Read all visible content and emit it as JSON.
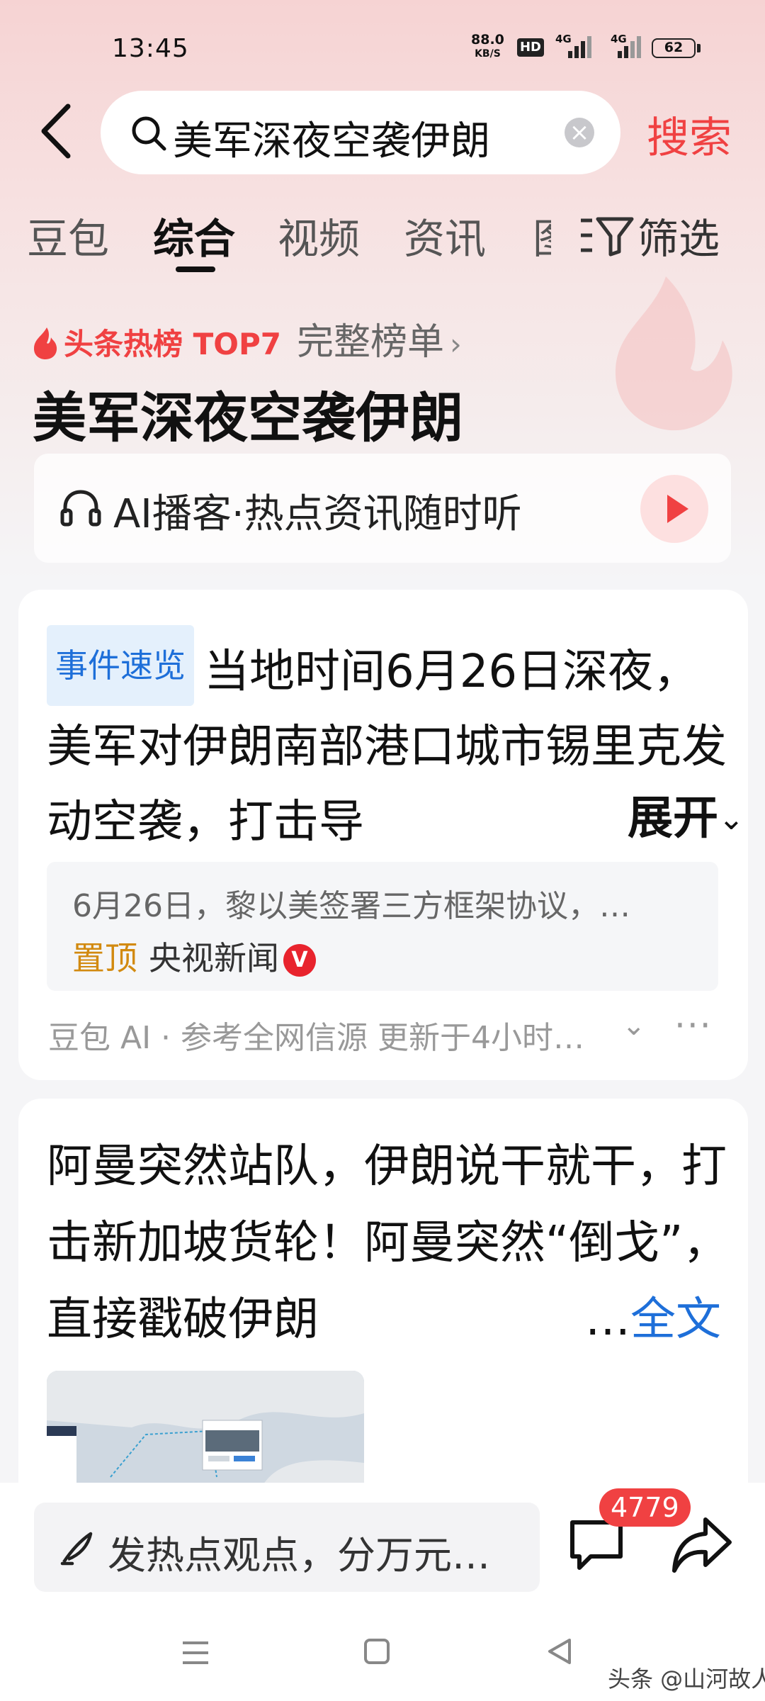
{
  "status_bar": {
    "time": "13:45",
    "net_speed_value": "88.0",
    "net_speed_unit": "KB/S",
    "hd_label": "HD",
    "net1": "4G",
    "net2": "4G",
    "battery": "62"
  },
  "search": {
    "query": "美军深夜空袭伊朗",
    "button_label": "搜索"
  },
  "tabs": {
    "items": [
      "豆包",
      "综合",
      "视频",
      "资讯"
    ],
    "active_index": 1,
    "partial_glyph": "图",
    "filter_label": "筛选"
  },
  "hot_rank": {
    "title": "头条热榜 TOP7",
    "link_label": "完整榜单",
    "chevron": "›",
    "topic": "美军深夜空袭伊朗"
  },
  "podcast": {
    "label": "AI播客·热点资讯随时听"
  },
  "summary_card": {
    "tag": "事件速览",
    "text": "当地时间6月26日深夜，美军对伊朗南部港口城市锡里克发动空袭，打击导",
    "expand_label": "展开",
    "reference_text": "6月26日，黎以美签署三方框架协议，…",
    "pin_label": "置顶",
    "source": "央视新闻",
    "verified_badge": "V",
    "ai_footer": "豆包 AI · 参考全网信源 更新于4小时…",
    "more_label": "···"
  },
  "article_card": {
    "text": "阿曼突然站队，伊朗说干就干，打击新加坡货轮！阿曼突然“倒戈”，直接戳破伊朗",
    "ellipsis": "…",
    "fulltext_label": "全文"
  },
  "bottom_bar": {
    "comment_placeholder": "发热点观点，分万元…",
    "comment_count": "4779"
  },
  "watermark": "头条 @山河故人",
  "colors": {
    "accent_red": "#f04142",
    "link_blue": "#1e6fd9",
    "pin_orange": "#d28a10"
  }
}
